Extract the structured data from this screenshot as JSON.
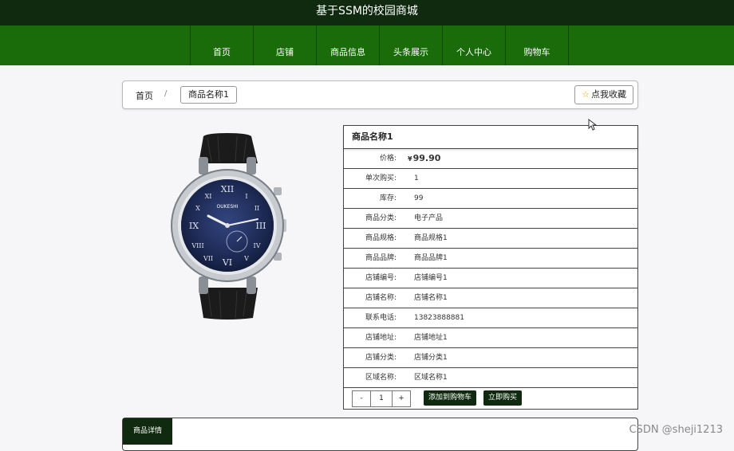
{
  "header": {
    "title": "基于SSM的校园商城"
  },
  "nav": [
    "首页",
    "店铺",
    "商品信息",
    "头条展示",
    "个人中心",
    "购物车"
  ],
  "breadcrumb": {
    "home": "首页",
    "separator": "/",
    "current": "商品名称1"
  },
  "favorite_button": "点我收藏",
  "product": {
    "name": "商品名称1",
    "price_label": "价格:",
    "currency": "¥",
    "price": "99.90",
    "rows": [
      {
        "label": "单次购买:",
        "value": "1"
      },
      {
        "label": "库存:",
        "value": "99"
      },
      {
        "label": "商品分类:",
        "value": "电子产品"
      },
      {
        "label": "商品规格:",
        "value": "商品规格1"
      },
      {
        "label": "商品品牌:",
        "value": "商品品牌1"
      },
      {
        "label": "店铺编号:",
        "value": "店铺编号1"
      },
      {
        "label": "店铺名称:",
        "value": "店铺名称1"
      },
      {
        "label": "联系电话:",
        "value": "13823888881"
      },
      {
        "label": "店铺地址:",
        "value": "店铺地址1"
      },
      {
        "label": "店铺分类:",
        "value": "店铺分类1"
      },
      {
        "label": "区域名称:",
        "value": "区域名称1"
      }
    ]
  },
  "purchase": {
    "minus": "-",
    "quantity": "1",
    "plus": "+",
    "add_to_cart": "添加到购物车",
    "buy_now": "立即购买"
  },
  "details_tab": "商品详情",
  "watermark": "CSDN @sheji1213",
  "watch_logo_text": "OUKESHI",
  "colors": {
    "dark_green": "#0f2a0f",
    "nav_green": "#1a6b0a"
  }
}
